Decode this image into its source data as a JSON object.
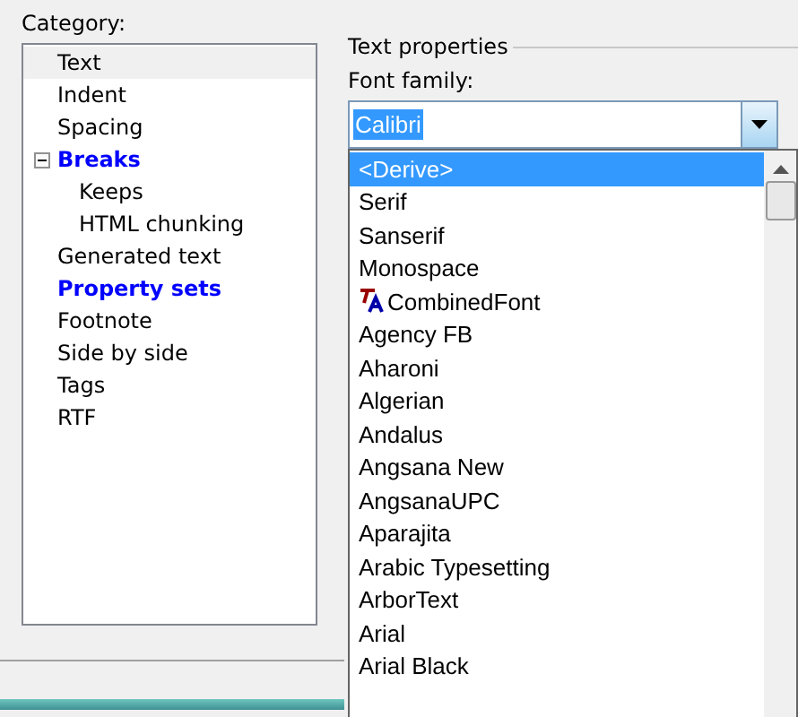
{
  "category": {
    "label": "Category:",
    "items": [
      {
        "label": "Text",
        "selected": true,
        "bold": false
      },
      {
        "label": "Indent",
        "selected": false,
        "bold": false
      },
      {
        "label": "Spacing",
        "selected": false,
        "bold": false
      },
      {
        "label": "Breaks",
        "selected": false,
        "bold": true,
        "expanded": true,
        "children": [
          {
            "label": "Keeps",
            "selected": false,
            "bold": false
          },
          {
            "label": "HTML chunking",
            "selected": false,
            "bold": false
          }
        ]
      },
      {
        "label": "Generated text",
        "selected": false,
        "bold": false
      },
      {
        "label": "Property sets",
        "selected": false,
        "bold": true
      },
      {
        "label": "Footnote",
        "selected": false,
        "bold": false
      },
      {
        "label": "Side by side",
        "selected": false,
        "bold": false
      },
      {
        "label": "Tags",
        "selected": false,
        "bold": false
      },
      {
        "label": "RTF",
        "selected": false,
        "bold": false
      }
    ]
  },
  "text_properties": {
    "title": "Text properties",
    "font_family": {
      "label": "Font family:",
      "value": "Calibri",
      "options": [
        {
          "label": "<Derive>",
          "selected": true,
          "kind": "plain"
        },
        {
          "label": "Serif",
          "selected": false,
          "kind": "plain"
        },
        {
          "label": "Sanserif",
          "selected": false,
          "kind": "plain"
        },
        {
          "label": "Monospace",
          "selected": false,
          "kind": "plain"
        },
        {
          "label": "CombinedFont",
          "selected": false,
          "kind": "combined"
        },
        {
          "label": "Agency FB",
          "selected": false,
          "kind": "plain"
        },
        {
          "label": "Aharoni",
          "selected": false,
          "kind": "plain"
        },
        {
          "label": "Algerian",
          "selected": false,
          "kind": "plain"
        },
        {
          "label": "Andalus",
          "selected": false,
          "kind": "plain"
        },
        {
          "label": "Angsana New",
          "selected": false,
          "kind": "plain"
        },
        {
          "label": "AngsanaUPC",
          "selected": false,
          "kind": "plain"
        },
        {
          "label": "Aparajita",
          "selected": false,
          "kind": "plain"
        },
        {
          "label": "Arabic Typesetting",
          "selected": false,
          "kind": "plain"
        },
        {
          "label": "ArborText",
          "selected": false,
          "kind": "plain"
        },
        {
          "label": "Arial",
          "selected": false,
          "kind": "plain"
        },
        {
          "label": "Arial Black",
          "selected": false,
          "kind": "plain"
        }
      ]
    }
  }
}
